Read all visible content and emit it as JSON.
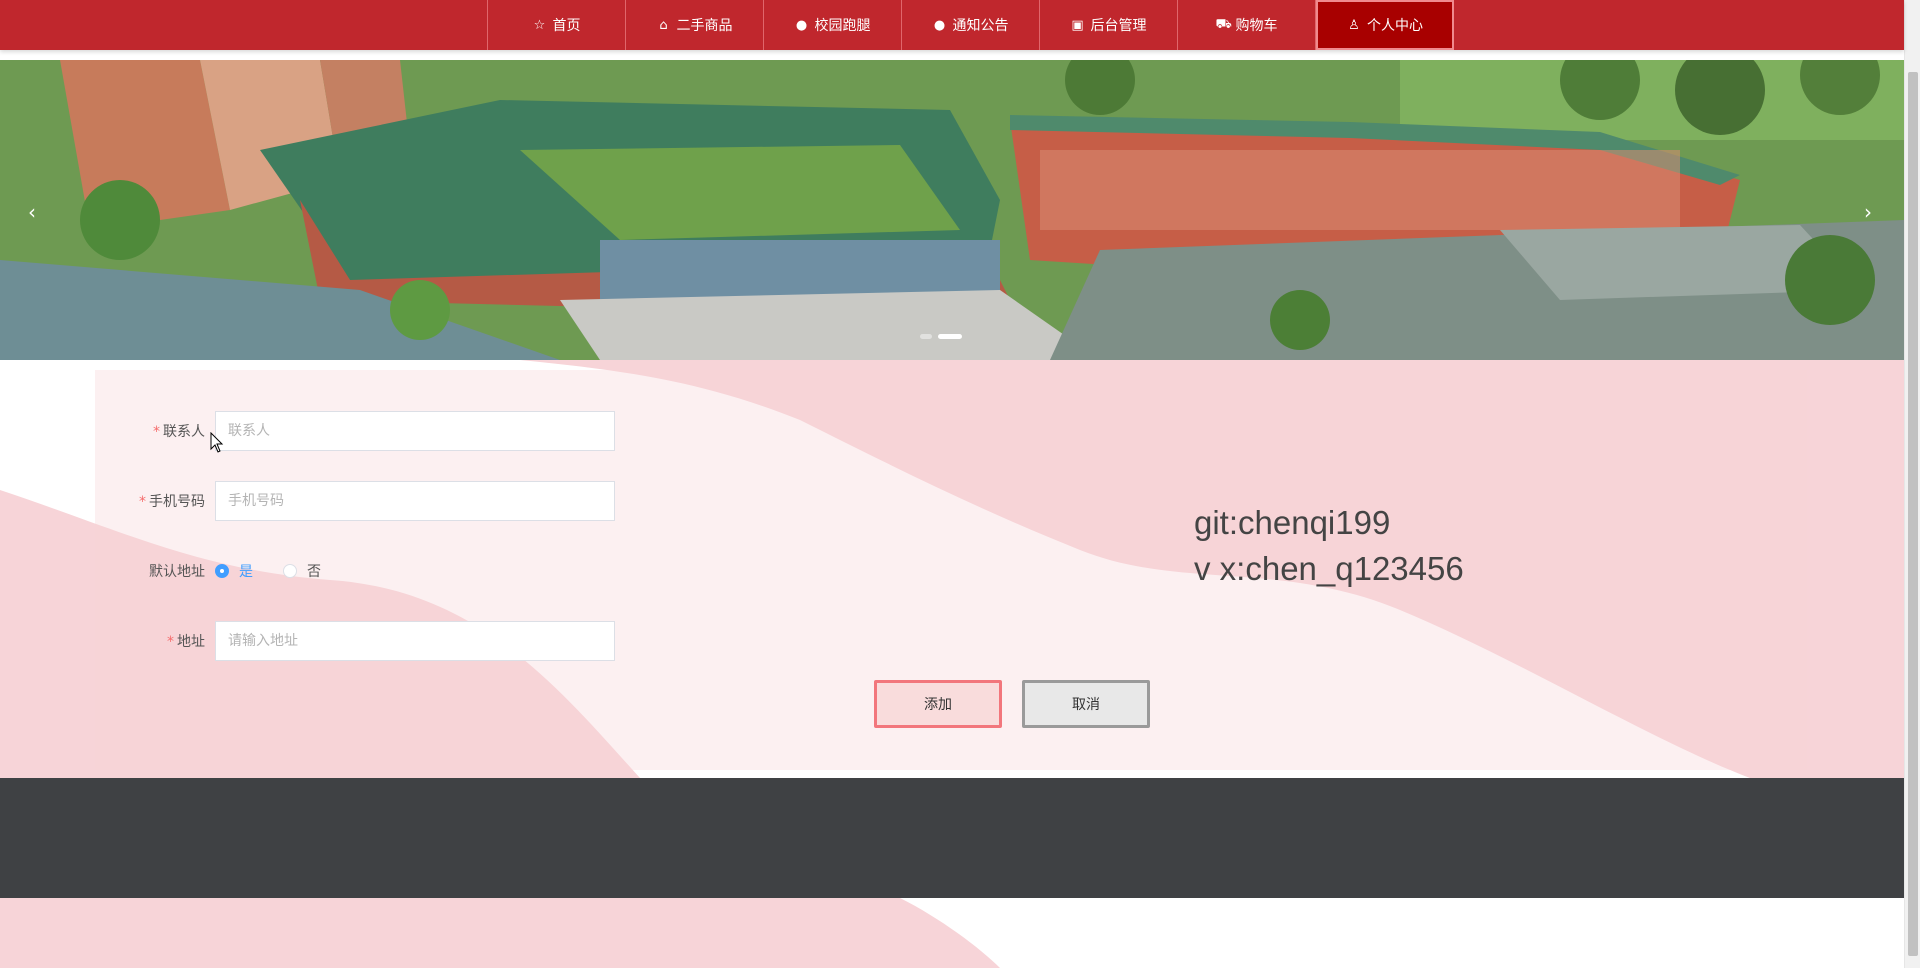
{
  "nav": {
    "items": [
      {
        "label": "首页",
        "icon": "☆",
        "icon_name": "star-icon"
      },
      {
        "label": "二手商品",
        "icon": "⌂",
        "icon_name": "bag-icon"
      },
      {
        "label": "校园跑腿",
        "icon": "●",
        "icon_name": "info-icon"
      },
      {
        "label": "通知公告",
        "icon": "●",
        "icon_name": "question-icon"
      },
      {
        "label": "后台管理",
        "icon": "▣",
        "icon_name": "clipboard-icon"
      },
      {
        "label": "购物车",
        "icon": "⛟",
        "icon_name": "cart-icon"
      },
      {
        "label": "个人中心",
        "icon": "♙",
        "icon_name": "user-icon"
      }
    ],
    "active_index": 6,
    "bg_color": "#c0272d",
    "active_color": "#a80000"
  },
  "carousel": {
    "prev": "‹",
    "next": "›",
    "dot_count": 2,
    "active_dot": 1
  },
  "form": {
    "contact": {
      "label": "联系人",
      "placeholder": "联系人",
      "value": ""
    },
    "phone": {
      "label": "手机号码",
      "placeholder": "手机号码",
      "value": ""
    },
    "default_address": {
      "label": "默认地址",
      "options": [
        "是",
        "否"
      ],
      "selected": "是"
    },
    "address": {
      "label": "地址",
      "placeholder": "请输入地址",
      "value": ""
    },
    "required_mark": "*"
  },
  "buttons": {
    "add": "添加",
    "cancel": "取消"
  },
  "watermark": {
    "line1": "git:chenqi199",
    "line2": "v x:chen_q123456"
  }
}
